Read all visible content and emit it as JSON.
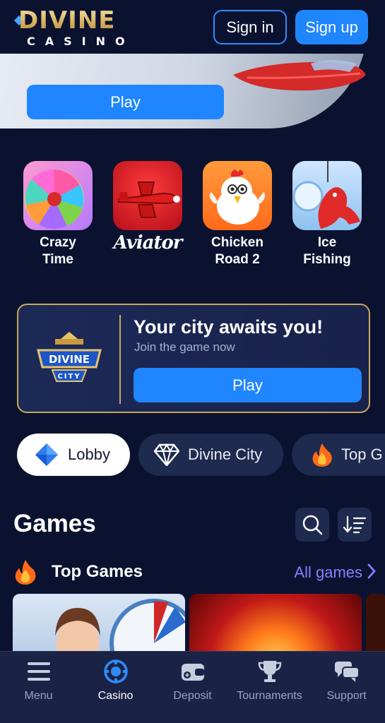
{
  "header": {
    "logo_text": "DIVINE",
    "logo_sub": "CASINO",
    "signin_label": "Sign in",
    "signup_label": "Sign up"
  },
  "hero": {
    "play_label": "Play"
  },
  "quick_games": [
    {
      "label": "Crazy\nTime",
      "icon": "crazy-time-wheel-icon"
    },
    {
      "label": "Aviator",
      "icon": "aviator-plane-icon"
    },
    {
      "label": "Chicken\nRoad 2",
      "icon": "chicken-icon"
    },
    {
      "label": "Ice\nFishing",
      "icon": "ice-fishing-icon"
    }
  ],
  "city_promo": {
    "logo_top": "DIVINE",
    "logo_bottom": "CITY",
    "title": "Your city awaits you!",
    "subtitle": "Join the game now",
    "play_label": "Play"
  },
  "tabs": [
    {
      "label": "Lobby",
      "icon": "blue-diamond-icon",
      "active": true
    },
    {
      "label": "Divine City",
      "icon": "white-diamond-icon",
      "active": false
    },
    {
      "label": "Top G",
      "icon": "fire-icon",
      "active": false
    }
  ],
  "games": {
    "title": "Games",
    "section_title": "Top Games",
    "all_games_label": "All games"
  },
  "bottom_nav": [
    {
      "label": "Menu",
      "icon": "menu-icon",
      "active": false
    },
    {
      "label": "Casino",
      "icon": "casino-chip-icon",
      "active": true
    },
    {
      "label": "Deposit",
      "icon": "wallet-icon",
      "active": false
    },
    {
      "label": "Tournaments",
      "icon": "trophy-icon",
      "active": false
    },
    {
      "label": "Support",
      "icon": "chat-icon",
      "active": false
    }
  ],
  "colors": {
    "background": "#0b1230",
    "accent_blue": "#1f86ff",
    "gold": "#c9a85c",
    "link_purple": "#8a7cff"
  }
}
